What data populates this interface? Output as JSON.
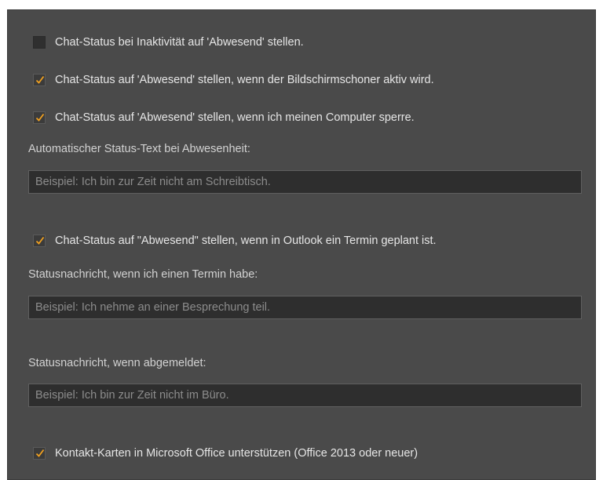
{
  "options": [
    {
      "label": "Chat-Status bei Inaktivität auf 'Abwesend' stellen.",
      "checked": false
    },
    {
      "label": "Chat-Status auf 'Abwesend' stellen, wenn der Bildschirmschoner aktiv wird.",
      "checked": true
    },
    {
      "label": "Chat-Status auf 'Abwesend' stellen, wenn ich meinen Computer sperre.",
      "checked": true
    },
    {
      "label": "Chat-Status auf \"Abwesend\" stellen, wenn in Outlook ein Termin geplant ist.",
      "checked": true
    },
    {
      "label": "Kontakt-Karten in Microsoft Office unterstützen (Office 2013 oder neuer)",
      "checked": true
    }
  ],
  "away_text": {
    "caption": "Automatischer Status-Text bei Abwesenheit:",
    "placeholder": "Beispiel: Ich bin zur Zeit nicht am Schreibtisch.",
    "value": ""
  },
  "meeting_text": {
    "caption": "Statusnachricht, wenn ich einen Termin habe:",
    "placeholder": "Beispiel: Ich nehme an einer Besprechung teil.",
    "value": ""
  },
  "offline_text": {
    "caption": "Statusnachricht, wenn abgemeldet:",
    "placeholder": "Beispiel: Ich bin zur Zeit nicht im Büro.",
    "value": ""
  },
  "colors": {
    "panel": "#4a4a4a",
    "checkmark": "#f0a020",
    "text": "#e6e6e6",
    "field_bg": "#2e2e2e"
  }
}
